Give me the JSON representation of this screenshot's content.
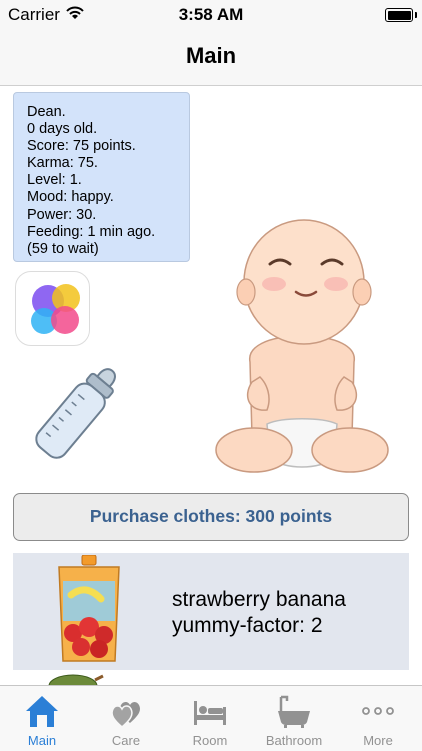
{
  "status_bar": {
    "carrier": "Carrier",
    "time": "3:58 AM"
  },
  "nav": {
    "title": "Main"
  },
  "stats": {
    "lines": [
      "Dean.",
      "0 days old.",
      "Score: 75 points.",
      "Karma: 75.",
      "Level: 1.",
      "Mood: happy.",
      "Power: 30.",
      "Feeding: 1 min ago.",
      "(59 to wait)"
    ]
  },
  "purchase_button": {
    "label": "Purchase clothes: 300 points"
  },
  "food_item": {
    "name": "strawberry banana",
    "factor": "yummy-factor: 2"
  },
  "tabs": [
    {
      "label": "Main",
      "icon": "house-icon",
      "active": true
    },
    {
      "label": "Care",
      "icon": "hearts-icon",
      "active": false
    },
    {
      "label": "Room",
      "icon": "bed-icon",
      "active": false
    },
    {
      "label": "Bathroom",
      "icon": "bathtub-icon",
      "active": false
    },
    {
      "label": "More",
      "icon": "more-icon",
      "active": false
    }
  ],
  "colors": {
    "tab_active": "#2b7fd6",
    "tab_inactive": "#929292",
    "stats_bg": "#d3e3fa",
    "button_text": "#3b6290"
  }
}
